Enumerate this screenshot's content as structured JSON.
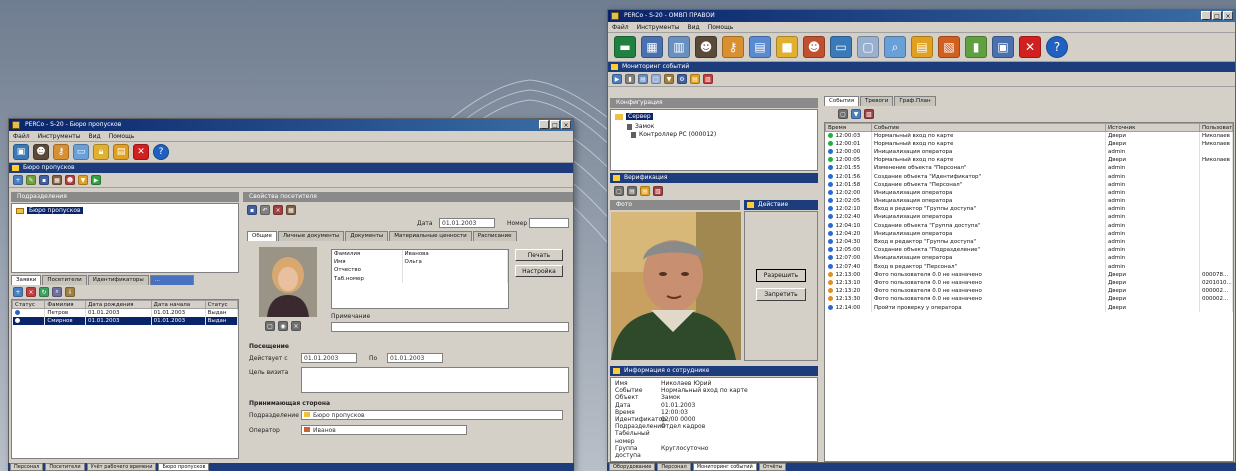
{
  "left_window": {
    "title": "PERCo - S-20 - Бюро пропусков",
    "menu": [
      "Файл",
      "Инструменты",
      "Вид",
      "Помощь"
    ],
    "toolbar_icons": [
      "connect-icon",
      "user-icon",
      "key-icon",
      "monitor-icon",
      "lock-icon",
      "folder-icon",
      "close-red-icon",
      "help-icon"
    ],
    "subbar_title": "Бюро пропусков",
    "org_title": "Подразделения",
    "tree_root": "Бюро пропусков",
    "tabs_bottom": [
      "Заявки",
      "Посетители",
      "Идентификаторы",
      "..."
    ],
    "grid": {
      "headers": [
        "Статус",
        "Фамилия",
        "Дата рождения",
        "Дата начала",
        "Статус"
      ],
      "rows": [
        [
          "",
          "Петров",
          "01.01.2003",
          "01.01.2003",
          "Выдан"
        ],
        [
          "",
          "Смирнов",
          "01.01.2003",
          "01.01.2003",
          "Выдан"
        ]
      ]
    },
    "detail_title": "Свойства посетителя",
    "detail_label_date": "Дата",
    "detail_date": "01.01.2003",
    "detail_label_num": "Номер",
    "detail_tabs": [
      "Общие",
      "Личные документы",
      "Документы",
      "Материальные ценности",
      "Расписание"
    ],
    "fields": [
      [
        "Фамилия",
        "Иванова"
      ],
      [
        "Имя",
        "Ольга"
      ],
      [
        "Отчество",
        ""
      ],
      [
        "Таб.номер",
        ""
      ]
    ],
    "note_label": "Примечание",
    "buttons": [
      "Печать",
      "Настройка"
    ],
    "visit_section": "Посещение",
    "visit_from_label": "Действует с",
    "visit_from": "01.01.2003",
    "visit_to_label": "По",
    "visit_to": "01.01.2003",
    "visit_purpose_label": "Цель визита",
    "host_section": "Принимающая сторона",
    "host_dept_label": "Подразделение",
    "host_dept": "Бюро пропусков",
    "host_person_label": "Оператор",
    "host_person": "Иванов",
    "taskbar": [
      "Персонал",
      "Посетители",
      "Учёт рабочего времени",
      "Бюро пропусков"
    ]
  },
  "right_window": {
    "title": "PERCo - S-20 - ОМВП ПРАВОИ",
    "menu": [
      "Файл",
      "Инструменты",
      "Вид",
      "Помощь"
    ],
    "subbar_title": "Мониторинг событий",
    "tree_title": "Конфигурация",
    "tree_items": [
      "Сервер",
      "Замок",
      "Контроллер PC (000012)"
    ],
    "photo_title": "Верификация",
    "photo_panel": "Фото",
    "side_panel": "Действие",
    "btn_allow": "Разрешить",
    "btn_deny": "Запретить",
    "info_title": "Информация о сотруднике",
    "info": [
      [
        "Имя",
        "Николаев Юрий"
      ],
      [
        "Событие",
        "Нормальный вход по карте"
      ],
      [
        "Объект",
        "Замок"
      ],
      [
        "Дата",
        "01.01.2003"
      ],
      [
        "Время",
        "12:00:03"
      ],
      [
        "Идентификатор",
        "02/00 0000"
      ],
      [
        "Подразделение",
        "Отдел кадров"
      ],
      [
        "Табельный номер",
        ""
      ],
      [
        "Группа доступа",
        "Круглосуточно"
      ]
    ],
    "event_tabs": [
      "События",
      "Тревоги",
      "Граф.План"
    ],
    "event_headers": [
      "Время",
      "Событие",
      "Источник",
      "Пользователь"
    ],
    "events": [
      [
        "green",
        "12:00:03",
        "Нормальный вход по карте",
        "Двери",
        "Николаев"
      ],
      [
        "green",
        "12:00:01",
        "Нормальный вход по карте",
        "Двери",
        "Николаев"
      ],
      [
        "blue",
        "12:00:00",
        "Инициализация оператора",
        "admin",
        ""
      ],
      [
        "green",
        "12:00:05",
        "Нормальный вход по карте",
        "Двери",
        "Николаев"
      ],
      [
        "blue",
        "12:01:55",
        "Изменение объекта \"Персонал\"",
        "admin",
        ""
      ],
      [
        "blue",
        "12:01:56",
        "Создание объекта \"Идентификатор\"",
        "admin",
        ""
      ],
      [
        "blue",
        "12:01:58",
        "Создание объекта \"Персонал\"",
        "admin",
        ""
      ],
      [
        "blue",
        "12:02:00",
        "Инициализация оператора",
        "admin",
        ""
      ],
      [
        "blue",
        "12:02:05",
        "Инициализация оператора",
        "admin",
        ""
      ],
      [
        "blue",
        "12:02:10",
        "Вход в редактор \"Группы доступа\"",
        "admin",
        ""
      ],
      [
        "blue",
        "12:02:40",
        "Инициализация оператора",
        "admin",
        ""
      ],
      [
        "blue",
        "12:04:10",
        "Создание объекта \"Группа доступа\"",
        "admin",
        ""
      ],
      [
        "blue",
        "12:04:20",
        "Инициализация оператора",
        "admin",
        ""
      ],
      [
        "blue",
        "12:04:30",
        "Вход в редактор \"Группы доступа\"",
        "admin",
        ""
      ],
      [
        "blue",
        "12:05:00",
        "Создание объекта \"Подразделение\"",
        "admin",
        ""
      ],
      [
        "blue",
        "12:07:00",
        "Инициализация оператора",
        "admin",
        ""
      ],
      [
        "blue",
        "12:07:40",
        "Вход в редактор \"Персонал\"",
        "admin",
        ""
      ],
      [
        "orange",
        "12:13:00",
        "Фото пользователя 0.0 не назначено",
        "Двери",
        "000078..."
      ],
      [
        "orange",
        "12:13:10",
        "Фото пользователя 0.0 не назначено",
        "Двери",
        "0201010..."
      ],
      [
        "orange",
        "12:13:20",
        "Фото пользователя 0.0 не назначено",
        "Двери",
        "000002..."
      ],
      [
        "orange",
        "12:13:30",
        "Фото пользователя 0.0 не назначено",
        "Двери",
        "000002..."
      ],
      [
        "blue",
        "12:14:00",
        "Пройти проверку у оператора",
        "Двери",
        ""
      ]
    ],
    "taskbar": [
      "Оборудование",
      "Персонал",
      "Мониторинг событий",
      "Отчёты"
    ]
  }
}
